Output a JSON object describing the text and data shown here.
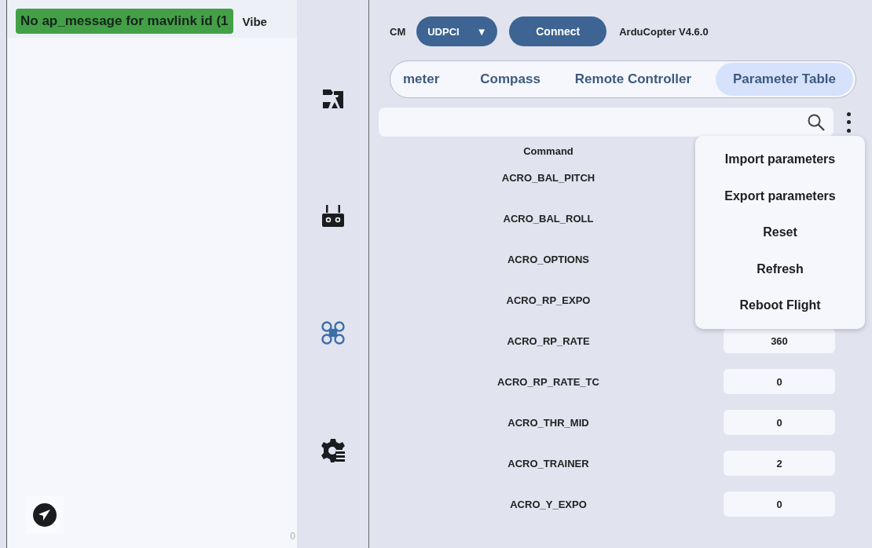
{
  "log": {
    "message": "No ap_message for mavlink id (1",
    "label": "Vibe",
    "percent": "0"
  },
  "toolbar": {
    "port_label": "CM",
    "port": "UDPCI",
    "dropdown_glyph": "▼",
    "connect": "Connect",
    "firmware": "ArduCopter V4.6.0"
  },
  "rail": [
    {
      "kind": "camera"
    },
    {
      "kind": "remote"
    },
    {
      "kind": "drone"
    },
    {
      "kind": "gear"
    }
  ],
  "tabs": [
    {
      "label": "meter",
      "selected": false
    },
    {
      "label": "Compass",
      "selected": false
    },
    {
      "label": "Remote Controller",
      "selected": false
    },
    {
      "label": "Parameter Table",
      "selected": true
    }
  ],
  "table": {
    "columns": [
      "Command"
    ],
    "rows": [
      {
        "name": "ACRO_BAL_PITCH"
      },
      {
        "name": "ACRO_BAL_ROLL"
      },
      {
        "name": "ACRO_OPTIONS"
      },
      {
        "name": "ACRO_RP_EXPO"
      },
      {
        "name": "ACRO_RP_RATE",
        "value": "360"
      },
      {
        "name": "ACRO_RP_RATE_TC",
        "value": "0"
      },
      {
        "name": "ACRO_THR_MID",
        "value": "0"
      },
      {
        "name": "ACRO_TRAINER",
        "value": "2"
      },
      {
        "name": "ACRO_Y_EXPO",
        "value": "0"
      }
    ]
  },
  "menu": [
    "Import parameters",
    "Export parameters",
    "Reset",
    "Refresh",
    "Reboot Flight"
  ]
}
